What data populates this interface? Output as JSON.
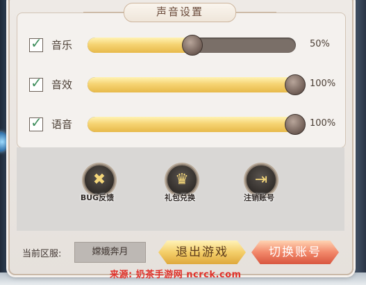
{
  "settings": {
    "title": "声音设置",
    "rows": [
      {
        "label": "音乐",
        "checked": true,
        "level": 0.5,
        "value_text": "50%"
      },
      {
        "label": "音效",
        "checked": true,
        "level": 1.0,
        "value_text": "100%"
      },
      {
        "label": "语音",
        "checked": true,
        "level": 1.0,
        "value_text": "100%"
      }
    ]
  },
  "actions": [
    {
      "label": "BUG反馈",
      "icon": "wrench-screwdriver-icon"
    },
    {
      "label": "礼包兑换",
      "icon": "gift-icon"
    },
    {
      "label": "注销账号",
      "icon": "logout-door-icon"
    }
  ],
  "footer": {
    "server_label": "当前区服:",
    "server_name": "嫦娥奔月",
    "exit_label": "退出游戏",
    "switch_label": "切换账号"
  },
  "watermark": "来源: 奶茶手游网 ncrck.com",
  "colors": {
    "slider_fill": "#f6d473",
    "slider_track": "#7a6f68",
    "checkbox_tick": "#3f8f5e",
    "exit_button": "#f4cf6a",
    "switch_button": "#f2886a",
    "watermark": "#e0312a"
  }
}
